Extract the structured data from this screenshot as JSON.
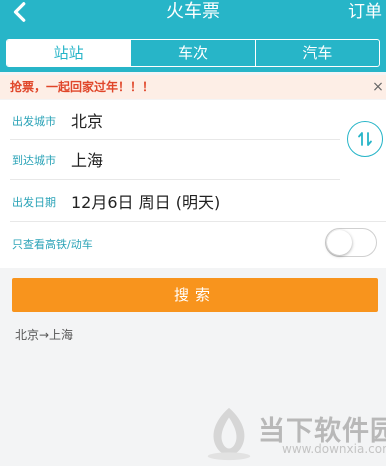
{
  "header": {
    "title": "火车票",
    "right_action": "订单",
    "tabs": [
      {
        "label": "站站",
        "active": true
      },
      {
        "label": "车次",
        "active": false
      },
      {
        "label": "汽车",
        "active": false
      }
    ]
  },
  "notice": {
    "text": "抢票，一起回家过年！！！",
    "close": "×"
  },
  "form": {
    "departure_label": "出发城市",
    "departure_value": "北京",
    "arrival_label": "到达城市",
    "arrival_value": "上海",
    "date_label": "出发日期",
    "date_value": "12月6日  周日 (明天)",
    "highspeed_label": "只查看高铁/动车",
    "highspeed_on": false
  },
  "search": {
    "label": "搜索"
  },
  "history": {
    "route": "北京→上海"
  },
  "watermark": {
    "name": "当下软件园",
    "url": "www.downxia.com"
  },
  "colors": {
    "accent": "#27b5c8",
    "button": "#f8941d",
    "notice_text": "#e0462a"
  },
  "icons": [
    "back-arrow-icon",
    "swap-arrows-icon",
    "close-icon"
  ]
}
